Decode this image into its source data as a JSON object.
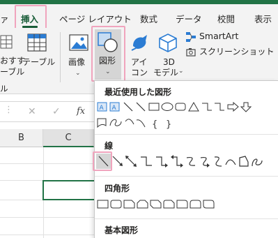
{
  "tabs": {
    "partial": "ァ",
    "insert": "挿入",
    "page_layout": "ページ レイアウト",
    "formulas": "数式",
    "data": "データ",
    "review": "校閲",
    "view": "表示"
  },
  "ribbon": {
    "recommended_line1": "おすす",
    "recommended_line2": "め",
    "recommended_line3": "ーブル",
    "table": "テーブル",
    "images": "画像",
    "shapes": "図形",
    "icons_line1": "アイ",
    "icons_line2": "コン",
    "model3d_line1": "3D",
    "model3d_line2": "モデル",
    "smartart": "SmartArt",
    "screenshot": "スクリーンショット",
    "group_partial": "ル"
  },
  "formula_bar": {
    "cancel": "✕",
    "enter": "✓",
    "fx": "fx"
  },
  "sheet": {
    "columns": [
      "B",
      "C"
    ]
  },
  "shapes_menu": {
    "recent_title": "最近使用した図形",
    "lines_title": "線",
    "rectangles_title": "四角形",
    "basic_title": "基本図形"
  },
  "colors": {
    "accent": "#217346",
    "highlight": "#f0a4bd"
  }
}
